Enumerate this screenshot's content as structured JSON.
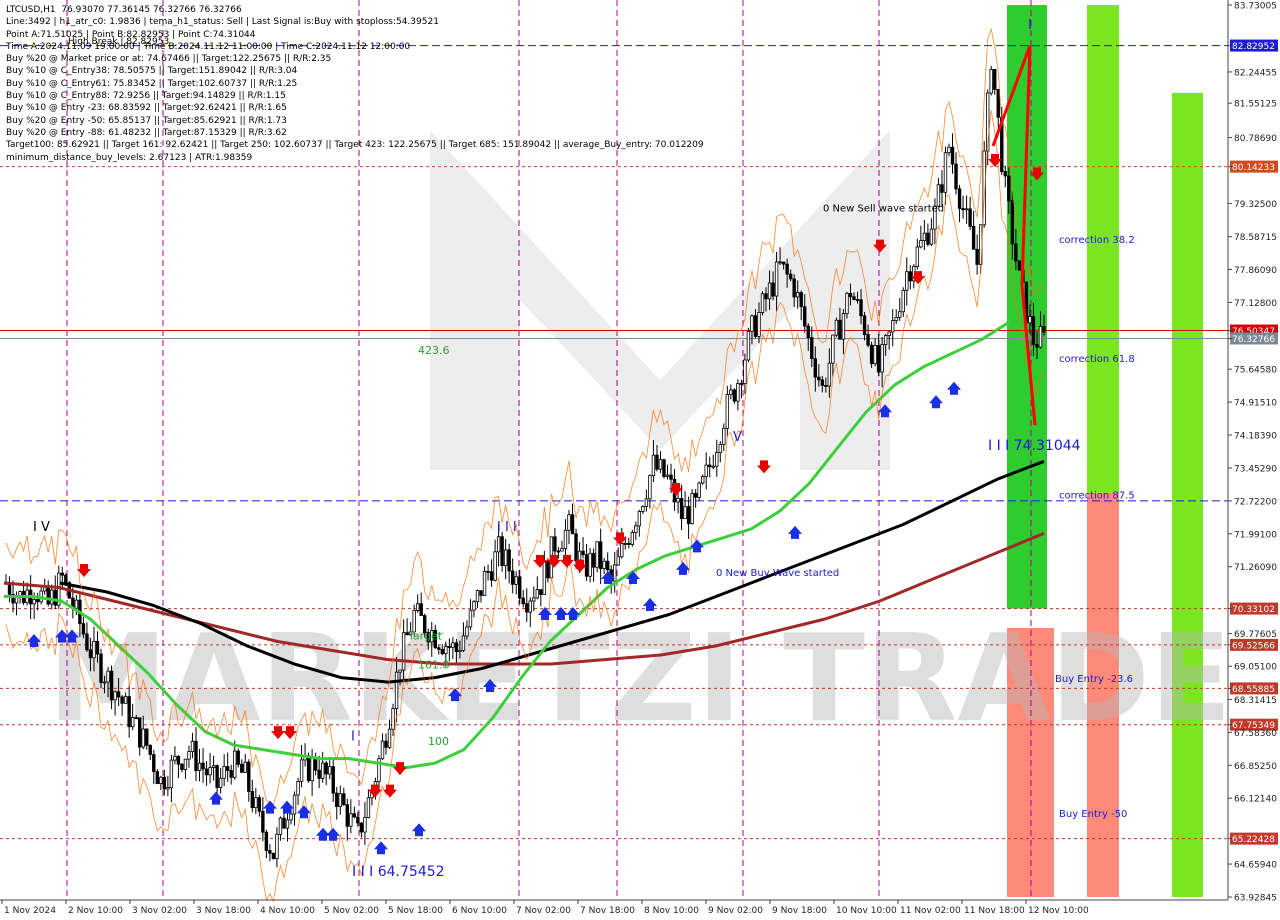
{
  "header": {
    "lines": [
      "LTCUSD,H1  76.93070 77.36145 76.32766 76.32766",
      "Line:3492 | h1_atr_c0: 1.9836 | tema_h1_status: Sell | Last Signal is:Buy with stoploss:54.39521",
      "Point A:71.51025 | Point B:82.82953 | Point C:74.31044",
      "Time A:2024.11.09 19:00:00 | Time B:2024.11.12 11:00:00 | Time C:2024.11.12 12:00:00",
      "Buy %20 @ Market price or at: 74.67466 || Target:122.25675 || R/R:2.35",
      "Buy %10 @ C_Entry38: 78.50575 || Target:151.89042 || R/R:3.04",
      "Buy %10 @ C_Entry61: 75.83452 || Target:102.60737 || R/R:1.25",
      "Buy %10 @ C_Entry88: 72.9256 || Target:94.14829 || R/R:1.15",
      "Buy %10 @ Entry -23: 68.83592 || Target:92.62421 || R/R:1.65",
      "Buy %20 @ Entry -50: 65.85137 || Target:85.62921 || R/R:1.73",
      "Buy %20 @ Entry -88: 61.48232 || Target:87.15329 || R/R:3.62",
      "Target100: 85.62921 || Target 161: 92.62421 || Target 250: 102.60737 || Target 423: 122.25675 || Target 685: 151.89042 || average_Buy_entry: 70.012209",
      "minimum_distance_buy_levels: 2.67123 | ATR:1.98359"
    ],
    "high_break_label": "High Break | 82.82953"
  },
  "watermark": "MARKETZI TRADE",
  "chart_data": {
    "type": "candlestick",
    "symbol": "LTCUSD",
    "timeframe": "H1",
    "ylim": [
      63.92845,
      83.73005
    ],
    "y_ticks": [
      "83.73005",
      "82.82952",
      "82.24455",
      "81.55125",
      "80.78690",
      "80.14233",
      "79.32500",
      "78.58715",
      "77.86090",
      "77.12800",
      "76.50347",
      "76.32766",
      "75.64580",
      "74.91510",
      "74.18390",
      "73.45290",
      "72.72200",
      "71.99100",
      "71.26090",
      "70.33102",
      "69.77605",
      "69.52566",
      "69.05100",
      "68.55885",
      "68.31415",
      "67.75349",
      "67.58360",
      "66.85250",
      "66.12140",
      "65.22428",
      "64.65940",
      "63.92845"
    ],
    "x_ticks": [
      "1 Nov 2024",
      "2 Nov 10:00",
      "3 Nov 02:00",
      "3 Nov 18:00",
      "4 Nov 10:00",
      "5 Nov 02:00",
      "5 Nov 18:00",
      "6 Nov 10:00",
      "7 Nov 02:00",
      "7 Nov 18:00",
      "8 Nov 10:00",
      "9 Nov 02:00",
      "9 Nov 18:00",
      "10 Nov 10:00",
      "11 Nov 02:00",
      "11 Nov 18:00",
      "12 Nov 10:00"
    ],
    "price_levels": [
      {
        "value": 82.82952,
        "label": "82.82952",
        "color": "#1c1cd1",
        "style": "dash"
      },
      {
        "value": 80.14233,
        "label": "80.14233",
        "color": "#d14a1c",
        "style": "dot"
      },
      {
        "value": 76.50347,
        "label": "76.50347",
        "color": "#d40000",
        "style": "solid"
      },
      {
        "value": 76.32766,
        "label": "76.32766",
        "color": "#7a8a99",
        "style": "solid"
      },
      {
        "value": 72.722,
        "label": "",
        "color": "#1c1cd1",
        "style": "dash"
      },
      {
        "value": 70.33102,
        "label": "70.33102",
        "color": "#c0392b",
        "style": "dot"
      },
      {
        "value": 69.52566,
        "label": "69.52566",
        "color": "#c0392b",
        "style": "dot"
      },
      {
        "value": 68.55885,
        "label": "68.55885",
        "color": "#c0392b",
        "style": "dot"
      },
      {
        "value": 67.75349,
        "label": "67.75349",
        "color": "#c0392b",
        "style": "dot"
      },
      {
        "value": 65.22428,
        "label": "65.22428",
        "color": "#c0392b",
        "style": "dot"
      }
    ],
    "annotations": [
      {
        "text": "0 New Sell wave started",
        "x": "10 Nov 10:00",
        "y": 79.15,
        "color": "#000000"
      },
      {
        "text": "0 New Buy Wave started",
        "x": "8 Nov 10:00",
        "y": 71.05,
        "color": "#1c1cd1"
      },
      {
        "text": "correction 38.2",
        "y": 78.45,
        "color": "#1c1cd1"
      },
      {
        "text": "correction 61.8",
        "y": 75.8,
        "color": "#1c1cd1"
      },
      {
        "text": "correction 87.5",
        "y": 72.78,
        "color": "#1c1cd1"
      },
      {
        "text": "Buy Entry -23.6",
        "y": 68.7,
        "color": "#1c1cd1"
      },
      {
        "text": "Buy Entry -50",
        "y": 65.7,
        "color": "#1c1cd1"
      },
      {
        "text": "423.6",
        "y": 75.98,
        "color": "#2ca02c"
      },
      {
        "text": "I I I 74.31044",
        "y": 73.85,
        "color": "#1c1cd1"
      },
      {
        "text": "I I I 64.75452",
        "y": 64.4,
        "color": "#1c1cd1"
      },
      {
        "text": "I V",
        "y": 72.05,
        "color": "#000000"
      },
      {
        "text": "I I I",
        "y": 72.05,
        "color": "#1c1cd1"
      },
      {
        "text": "V",
        "y": 74.05,
        "color": "#1c1cd1"
      },
      {
        "text": "I",
        "y": 67.4,
        "color": "#1c1cd1"
      },
      {
        "text": "I",
        "y": 83.2,
        "color": "#1c1cd1"
      },
      {
        "text": "Target",
        "y": 69.65,
        "color": "#2ca02c"
      },
      {
        "text": "161.8",
        "y": 69.0,
        "color": "#2ca02c"
      },
      {
        "text": "100",
        "y": 67.3,
        "color": "#2ca02c"
      }
    ],
    "zigzag": {
      "color": "#ff0000",
      "points": [
        {
          "x": "11 Nov 18:00",
          "y": 80.6
        },
        {
          "x": "12 Nov 10:00",
          "y": 82.82953
        },
        {
          "x": "12 Nov 10:00",
          "y": 74.31044
        }
      ]
    },
    "candles_note": "approximate price path from 1 Nov 2024 to 12 Nov 2024 13:00",
    "price_path": [
      70.9,
      70.6,
      70.8,
      70.4,
      71.0,
      70.2,
      69.4,
      68.9,
      68.4,
      67.8,
      67.3,
      66.5,
      66.9,
      67.2,
      66.8,
      66.4,
      66.9,
      66.6,
      65.6,
      64.9,
      65.9,
      66.7,
      66.9,
      66.5,
      65.9,
      65.3,
      66.3,
      67.6,
      69.2,
      70.2,
      69.9,
      69.6,
      69.4,
      70.1,
      71.0,
      71.6,
      71.1,
      70.6,
      70.9,
      71.8,
      72.1,
      71.2,
      71.5,
      70.9,
      71.8,
      72.6,
      73.5,
      73.2,
      72.4,
      72.6,
      73.5,
      74.6,
      75.4,
      76.5,
      77.2,
      77.9,
      77.5,
      76.3,
      75.2,
      76.4,
      77.4,
      76.6,
      75.6,
      76.6,
      77.8,
      78.4,
      79.1,
      80.6,
      79.2,
      78.0,
      82.6,
      79.6,
      77.6,
      76.3
    ],
    "ma_green": [
      70.6,
      70.6,
      70.5,
      70.1,
      69.5,
      68.9,
      68.2,
      67.6,
      67.3,
      67.2,
      67.1,
      67.0,
      67.0,
      66.9,
      66.8,
      66.9,
      67.2,
      67.9,
      68.8,
      69.6,
      70.2,
      70.8,
      71.2,
      71.5,
      71.7,
      71.9,
      72.1,
      72.5,
      73.1,
      73.9,
      74.7,
      75.3,
      75.7,
      76.0,
      76.3,
      76.7
    ],
    "ma_black": [
      70.9,
      70.7,
      70.4,
      70.0,
      69.5,
      69.1,
      68.8,
      68.7,
      68.8,
      69.0,
      69.3,
      69.6,
      69.9,
      70.2,
      70.6,
      71.0,
      71.4,
      71.8,
      72.2,
      72.7,
      73.2,
      73.6
    ],
    "ma_darkred": [
      70.9,
      70.8,
      70.5,
      70.2,
      69.9,
      69.6,
      69.4,
      69.2,
      69.1,
      69.1,
      69.1,
      69.2,
      69.3,
      69.5,
      69.8,
      70.1,
      70.5,
      71.0,
      71.5,
      72.0
    ],
    "zones": [
      {
        "color": "#2ecc2e",
        "y0": 83.73005,
        "y1": 70.33102
      },
      {
        "color": "#ff8a7a",
        "y0": 69.9,
        "y1": 63.92845
      },
      {
        "color": "#7be61f",
        "y0": 83.73005,
        "y1": 63.92845
      },
      {
        "color": "#7be61f",
        "y0": 72.9,
        "y1": 63.92845
      },
      {
        "color": "#ff8a7a",
        "y0": 72.9,
        "y1": 63.92845
      }
    ]
  }
}
